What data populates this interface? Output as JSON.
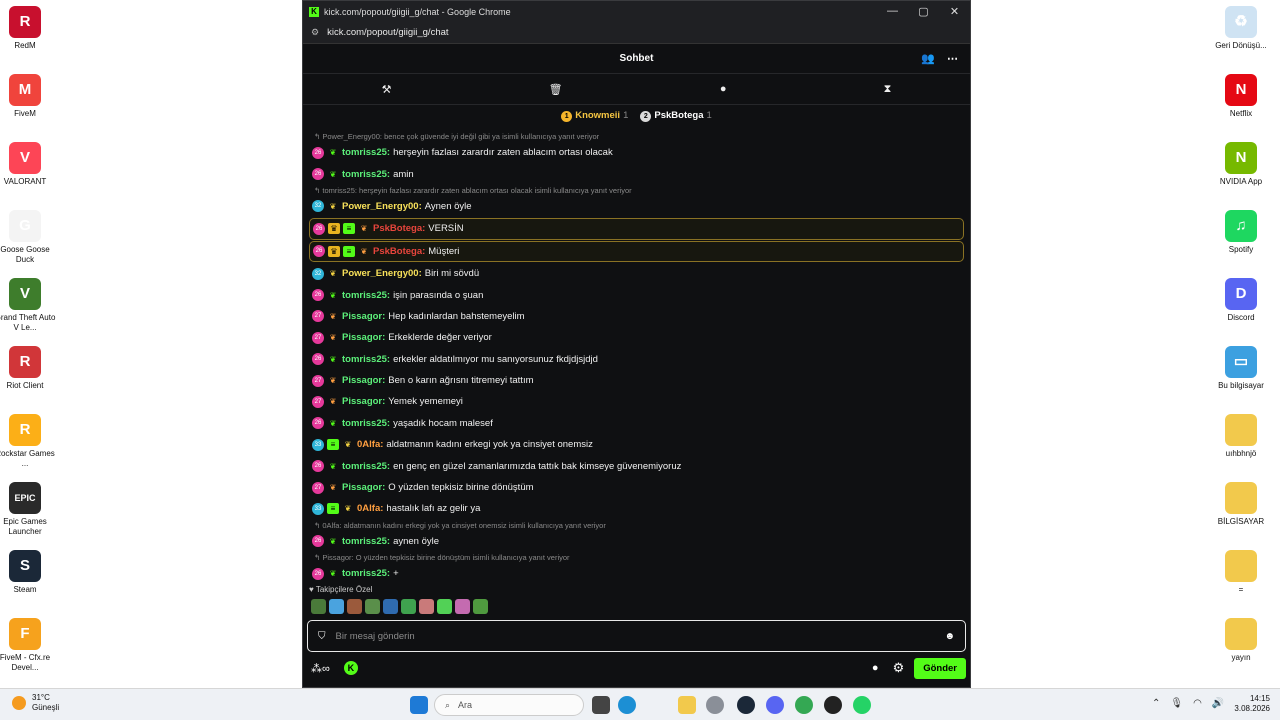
{
  "desktop_left": [
    {
      "label": "RedM",
      "glyph": "R",
      "color": "#c8102e"
    },
    {
      "label": "FiveM",
      "glyph": "M",
      "color": "#f0443c"
    },
    {
      "label": "VALORANT",
      "glyph": "V",
      "color": "#fd4556"
    },
    {
      "label": "Goose Goose Duck",
      "glyph": "G",
      "color": "#f4f4f4"
    },
    {
      "label": "Grand Theft Auto V Le...",
      "glyph": "V",
      "color": "#3e7d2c"
    },
    {
      "label": "Riot Client",
      "glyph": "R",
      "color": "#d13639"
    },
    {
      "label": "Rockstar Games ...",
      "glyph": "R",
      "color": "#fcaf17"
    },
    {
      "label": "Epic Games Launcher",
      "glyph": "EPIC",
      "color": "#2a2a2a"
    },
    {
      "label": "Steam",
      "glyph": "S",
      "color": "#1b2838"
    },
    {
      "label": "FiveM - Cfx.re Devel...",
      "glyph": "F",
      "color": "#f6a21d"
    }
  ],
  "desktop_right": [
    {
      "label": "Geri Dönüşü...",
      "glyph": "♻",
      "color": "#cfe3f3"
    },
    {
      "label": "Netflix",
      "glyph": "N",
      "color": "#e50914"
    },
    {
      "label": "NVIDIA App",
      "glyph": "N",
      "color": "#76b900"
    },
    {
      "label": "Spotify",
      "glyph": "♫",
      "color": "#1ed760"
    },
    {
      "label": "Discord",
      "glyph": "D",
      "color": "#5865f2"
    },
    {
      "label": "Bu bilgisayar",
      "glyph": "▭",
      "color": "#3ca0e0"
    },
    {
      "label": "uıhbhnjö",
      "glyph": "",
      "color": "#f2c94c"
    },
    {
      "label": "BİLGİSAYAR",
      "glyph": "",
      "color": "#f2c94c"
    },
    {
      "label": "=",
      "glyph": "",
      "color": "#f2c94c"
    },
    {
      "label": "yayın",
      "glyph": "",
      "color": "#f2c94c"
    }
  ],
  "window": {
    "title": "kick.com/popout/giigii_g/chat - Google Chrome",
    "url": "kick.com/popout/giigii_g/chat",
    "controls": [
      "—",
      "▢",
      "✕"
    ]
  },
  "chat": {
    "header": "Sohbet",
    "top_gifters": [
      {
        "rank": "1",
        "name": "Knowmeii",
        "count": "1",
        "rank_color": "#f5b52b",
        "name_color": "#f5c542"
      },
      {
        "rank": "2",
        "name": "PskBotega",
        "count": "1",
        "rank_color": "#d9d9d9",
        "name_color": "#ffffff"
      }
    ],
    "messages": [
      {
        "reply": "Power_Energy00: bence çok güvende iyi değil gibi ya isimli kullanıcıya yanıt veriyor"
      },
      {
        "user": "tomriss25",
        "text": "herşeyin fazlası zarardır zaten ablacım ortası olacak",
        "color": "#5cf07a",
        "badge": "26",
        "bcolor": "#e6399b",
        "wing": "#53fc18"
      },
      {
        "user": "tomriss25",
        "text": "amin",
        "color": "#5cf07a",
        "badge": "26",
        "bcolor": "#e6399b",
        "wing": "#53fc18"
      },
      {
        "reply": "tomriss25: herşeyin fazlası zarardır zaten ablacım ortası olacak isimli kullanıcıya yanıt veriyor"
      },
      {
        "user": "Power_Energy00",
        "text": "Aynen öyle",
        "color": "#f8e15a",
        "badge": "32",
        "bcolor": "#2fb5d8",
        "wing": "#f5d442"
      },
      {
        "user": "PskBotega",
        "text": "VERSİN",
        "color": "#e8453c",
        "badge": "26",
        "bcolor": "#e6399b",
        "wing": "#ff9f40",
        "hl": true
      },
      {
        "user": "PskBotega",
        "text": "Müşteri",
        "color": "#e8453c",
        "badge": "26",
        "bcolor": "#e6399b",
        "wing": "#ff9f40",
        "hl": true
      },
      {
        "user": "Power_Energy00",
        "text": "Biri mi sövdü",
        "color": "#f8e15a",
        "badge": "32",
        "bcolor": "#2fb5d8",
        "wing": "#f5d442"
      },
      {
        "user": "tomriss25",
        "text": "işin parasında o şuan",
        "color": "#5cf07a",
        "badge": "26",
        "bcolor": "#e6399b",
        "wing": "#53fc18"
      },
      {
        "user": "Pissagor",
        "text": "Hep kadınlardan bahstemeyelim",
        "color": "#5cf07a",
        "badge": "27",
        "bcolor": "#e6399b",
        "wing": "#ff9f40"
      },
      {
        "user": "Pissagor",
        "text": "Erkeklerde değer veriyor",
        "color": "#5cf07a",
        "badge": "27",
        "bcolor": "#e6399b",
        "wing": "#ff9f40"
      },
      {
        "user": "tomriss25",
        "text": "erkekler aldatılmıyor mu sanıyorsunuz fkdjdjsjdjd",
        "color": "#5cf07a",
        "badge": "26",
        "bcolor": "#e6399b",
        "wing": "#53fc18"
      },
      {
        "user": "Pissagor",
        "text": "Ben o karın ağrısnı titremeyi tattım",
        "color": "#5cf07a",
        "badge": "27",
        "bcolor": "#e6399b",
        "wing": "#ff9f40"
      },
      {
        "user": "Pissagor",
        "text": "Yemek yememeyi",
        "color": "#5cf07a",
        "badge": "27",
        "bcolor": "#e6399b",
        "wing": "#ff9f40"
      },
      {
        "user": "tomriss25",
        "text": "yaşadık hocam malesef",
        "color": "#5cf07a",
        "badge": "26",
        "bcolor": "#e6399b",
        "wing": "#53fc18"
      },
      {
        "user": "0Alfa",
        "text": "aldatmanın kadını erkegi yok ya cinsiyet onemsiz",
        "color": "#ff9f40",
        "badge": "33",
        "bcolor": "#2fb5d8",
        "wing": "#f5d442",
        "gift": true
      },
      {
        "user": "tomriss25",
        "text": "en genç en güzel zamanlarımızda tattık bak kimseye güvenemiyoruz",
        "color": "#5cf07a",
        "badge": "26",
        "bcolor": "#e6399b",
        "wing": "#53fc18"
      },
      {
        "user": "Pissagor",
        "text": "O yüzden tepkisiz birine dönüştüm",
        "color": "#5cf07a",
        "badge": "27",
        "bcolor": "#e6399b",
        "wing": "#ff9f40"
      },
      {
        "user": "0Alfa",
        "text": "hastalık lafı az gelir ya",
        "color": "#ff9f40",
        "badge": "33",
        "bcolor": "#2fb5d8",
        "wing": "#f5d442",
        "gift": true
      },
      {
        "reply": "0Alfa: aldatmanın kadını erkegi yok ya cinsiyet onemsiz isimli kullanıcıya yanıt veriyor"
      },
      {
        "user": "tomriss25",
        "text": "aynen öyle",
        "color": "#5cf07a",
        "badge": "26",
        "bcolor": "#e6399b",
        "wing": "#53fc18"
      },
      {
        "reply": "Pissagor: O yüzden tepkisiz birine dönüştüm isimli kullanıcıya yanıt veriyor"
      },
      {
        "user": "tomriss25",
        "text": "+",
        "color": "#5cf07a",
        "badge": "26",
        "bcolor": "#e6399b",
        "wing": "#53fc18"
      }
    ],
    "followers_label": "Takipçilere Özel",
    "emote_colors": [
      "#4a7a3a",
      "#4aa3df",
      "#9b5a3c",
      "#5a8f4a",
      "#2f6bb0",
      "#3fa34f",
      "#c97a7a",
      "#52d156",
      "#c46bb0",
      "#4f9a3f"
    ],
    "input_placeholder": "Bir mesaj gönderin",
    "send_label": "Gönder"
  },
  "taskbar": {
    "weather_temp": "31°C",
    "weather_desc": "Güneşli",
    "search_placeholder": "Ara",
    "time": "14:15",
    "date": "3.08.2026"
  }
}
